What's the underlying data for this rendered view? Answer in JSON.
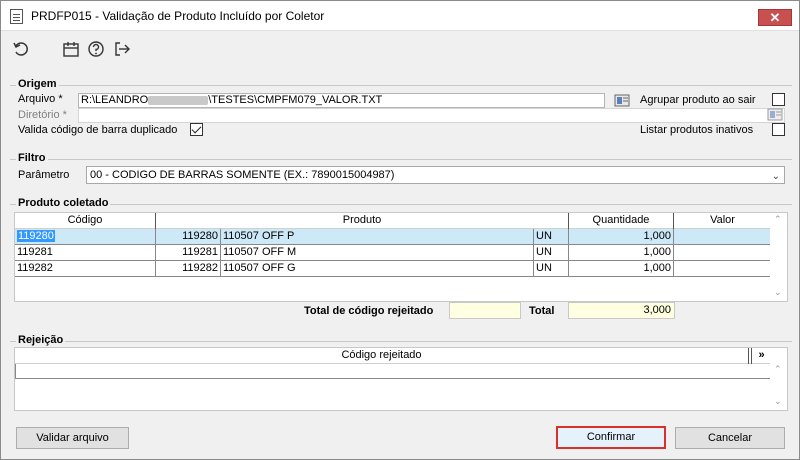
{
  "window": {
    "title": "PRDFP015 - Validação de Produto Incluído por Coletor",
    "close_label": "✕"
  },
  "toolbar": {
    "icons": [
      "refresh-icon",
      "calendar-icon",
      "help-icon",
      "exit-icon"
    ]
  },
  "origem": {
    "group_label": "Origem",
    "arquivo_label": "Arquivo *",
    "arquivo_value_prefix": "R:\\LEANDRO",
    "arquivo_value_suffix": "\\TESTES\\CMPFM079_VALOR.TXT",
    "diretorio_label": "Diretório *",
    "diretorio_value": "",
    "agrupar_label": "Agrupar produto ao sair",
    "agrupar_checked": false,
    "valida_label": "Valida código de barra duplicado",
    "valida_checked": true,
    "listar_label": "Listar produtos inativos",
    "listar_checked": false
  },
  "filtro": {
    "group_label": "Filtro",
    "parametro_label": "Parâmetro",
    "parametro_value": "00 - CODIGO DE BARRAS SOMENTE (EX.: 7890015004987)"
  },
  "produto_coletado": {
    "group_label": "Produto coletado",
    "columns": [
      "Código",
      "Produto",
      "Quantidade",
      "Valor"
    ],
    "rows": [
      {
        "codigo": "119280",
        "prod_code": "119280",
        "prod_desc": "110507 OFF P",
        "unidade": "UN",
        "quantidade": "1,000",
        "valor": ""
      },
      {
        "codigo": "119281",
        "prod_code": "119281",
        "prod_desc": "110507 OFF M",
        "unidade": "UN",
        "quantidade": "1,000",
        "valor": ""
      },
      {
        "codigo": "119282",
        "prod_code": "119282",
        "prod_desc": "110507 OFF G",
        "unidade": "UN",
        "quantidade": "1,000",
        "valor": ""
      }
    ],
    "selected_row": 0,
    "total_rejeitado_label": "Total de código rejeitado",
    "total_rejeitado_value": "",
    "total_label": "Total",
    "total_value": "3,000"
  },
  "rejeicao": {
    "group_label": "Rejeição",
    "column": "Código rejeitado",
    "expand_label": "»"
  },
  "buttons": {
    "validar": "Validar arquivo",
    "confirmar": "Confirmar",
    "cancelar": "Cancelar"
  }
}
